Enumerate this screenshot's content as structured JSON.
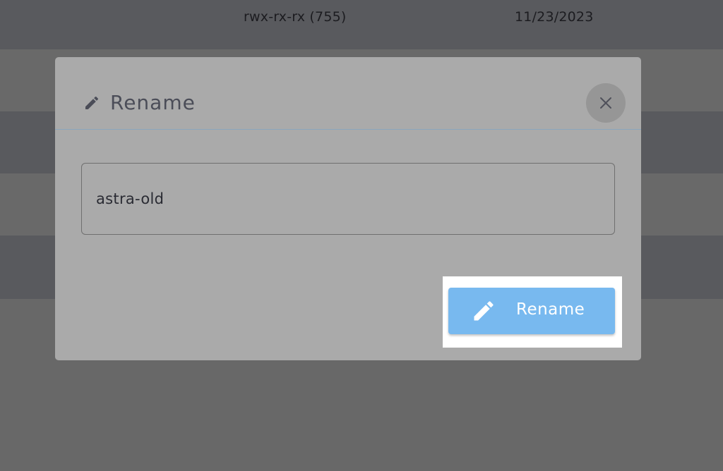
{
  "background_table": {
    "rows": [
      {
        "permissions": "rwx-rx-rx (755)",
        "modified": "11/23/2023"
      }
    ]
  },
  "dialog": {
    "title": "Rename",
    "title_icon": "pencil-icon",
    "close_icon": "close-icon",
    "input_value": "astra-old",
    "submit_label": "Rename",
    "submit_icon": "pencil-icon"
  },
  "colors": {
    "overlay_dark_row": "#595a5e",
    "modal_background": "#aaaaaa",
    "primary_button": "#78b9ef",
    "title_text": "#4b4d58"
  }
}
